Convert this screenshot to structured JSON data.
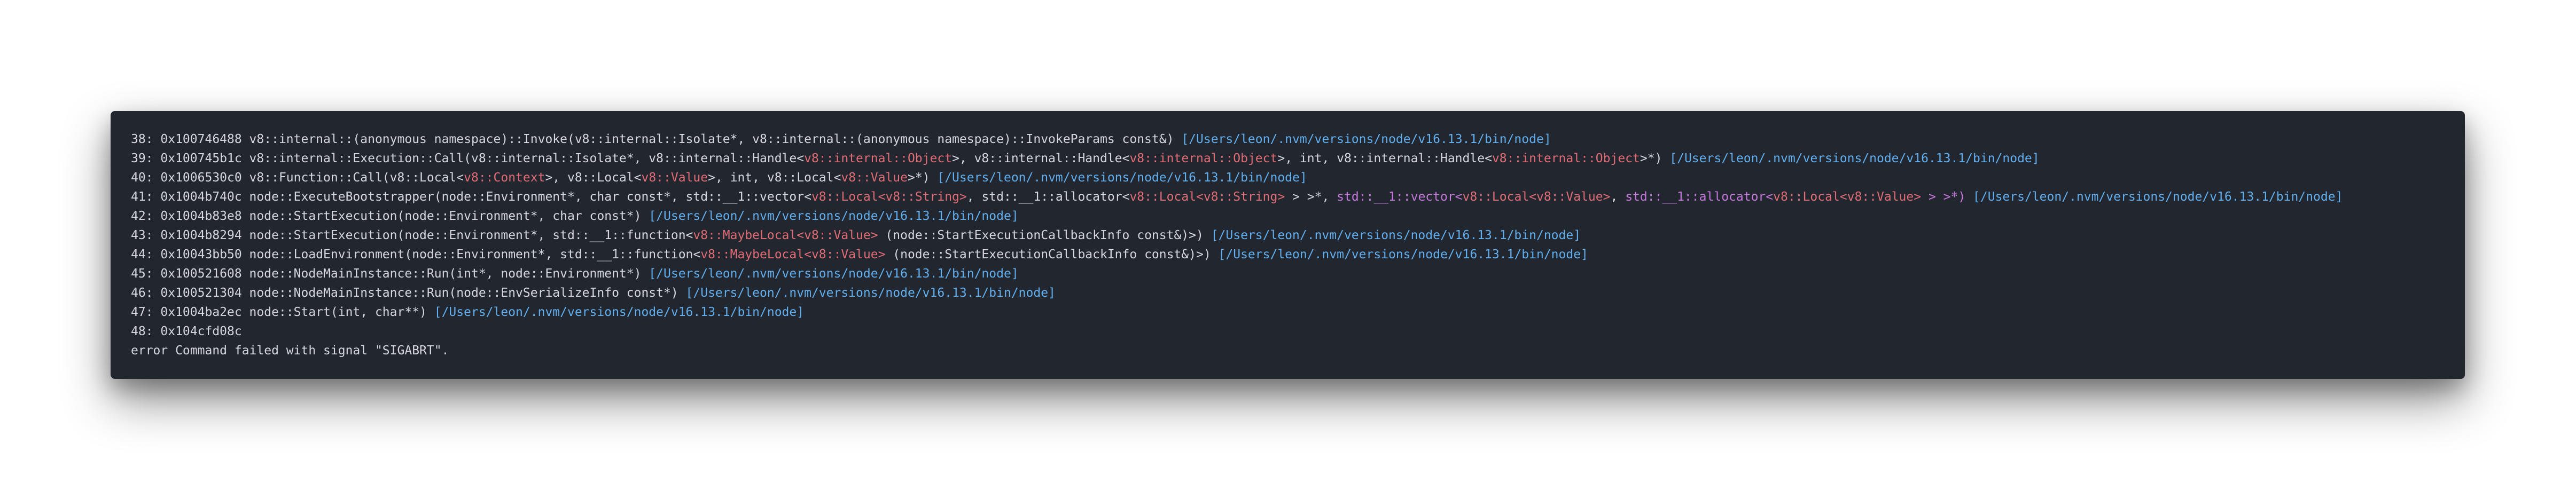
{
  "colors": {
    "background": "#22262e",
    "text": "#d4d8de",
    "type_highlight": "#e06c75",
    "path": "#61afef",
    "namespace": "#c678dd"
  },
  "lines": [
    [
      {
        "t": "38: 0x100746488 v8::internal::(anonymous namespace)::Invoke(v8::internal::Isolate*, v8::internal::(anonymous namespace)::InvokeParams const&) ",
        "c": "plain"
      },
      {
        "t": "[/Users/leon/.nvm/versions/node/v16.13.1/bin/node]",
        "c": "path"
      }
    ],
    [
      {
        "t": "39: 0x100745b1c v8::internal::Execution::Call(v8::internal::Isolate*, v8::internal::Handle<",
        "c": "plain"
      },
      {
        "t": "v8::internal::Object",
        "c": "type"
      },
      {
        "t": ">, v8::internal::Handle<",
        "c": "plain"
      },
      {
        "t": "v8::internal::Object",
        "c": "type"
      },
      {
        "t": ">, int, v8::internal::Handle<",
        "c": "plain"
      },
      {
        "t": "v8::internal::Object",
        "c": "type"
      },
      {
        "t": ">*) ",
        "c": "plain"
      },
      {
        "t": "[/Users/leon/.nvm/versions/node/v16.13.1/bin/node]",
        "c": "path"
      }
    ],
    [
      {
        "t": "40: 0x1006530c0 v8::Function::Call(v8::Local<",
        "c": "plain"
      },
      {
        "t": "v8::Context",
        "c": "type"
      },
      {
        "t": ">, v8::Local<",
        "c": "plain"
      },
      {
        "t": "v8::Value",
        "c": "type"
      },
      {
        "t": ">, int, v8::Local<",
        "c": "plain"
      },
      {
        "t": "v8::Value",
        "c": "type"
      },
      {
        "t": ">*) ",
        "c": "plain"
      },
      {
        "t": "[/Users/leon/.nvm/versions/node/v16.13.1/bin/node]",
        "c": "path"
      }
    ],
    [
      {
        "t": "41: 0x1004b740c node::ExecuteBootstrapper(node::Environment*, char const*, std::__1::vector<",
        "c": "plain"
      },
      {
        "t": "v8::Local<v8::String>",
        "c": "type"
      },
      {
        "t": ", std::__1::allocator<",
        "c": "plain"
      },
      {
        "t": "v8::Local<v8::String>",
        "c": "type"
      },
      {
        "t": " > >*, ",
        "c": "plain"
      },
      {
        "t": "std::__1::vector<",
        "c": "ns"
      },
      {
        "t": "v8::Local<v8::Value>",
        "c": "type"
      },
      {
        "t": ", ",
        "c": "plain"
      },
      {
        "t": "std::__1::allocator<",
        "c": "ns"
      },
      {
        "t": "v8::Local<v8::Value>",
        "c": "type"
      },
      {
        "t": " > >*) ",
        "c": "ns"
      },
      {
        "t": "[/Users/leon/.nvm/versions/node/v16.13.1/bin/node]",
        "c": "path"
      }
    ],
    [
      {
        "t": "42: 0x1004b83e8 node::StartExecution(node::Environment*, char const*) ",
        "c": "plain"
      },
      {
        "t": "[/Users/leon/.nvm/versions/node/v16.13.1/bin/node]",
        "c": "path"
      }
    ],
    [
      {
        "t": "43: 0x1004b8294 node::StartExecution(node::Environment*, std::__1::function<",
        "c": "plain"
      },
      {
        "t": "v8::MaybeLocal<v8::Value>",
        "c": "type"
      },
      {
        "t": " (node::StartExecutionCallbackInfo const&)>) ",
        "c": "plain"
      },
      {
        "t": "[/Users/leon/.nvm/versions/node/v16.13.1/bin/node]",
        "c": "path"
      }
    ],
    [
      {
        "t": "44: 0x10043bb50 node::LoadEnvironment(node::Environment*, std::__1::function<",
        "c": "plain"
      },
      {
        "t": "v8::MaybeLocal<v8::Value>",
        "c": "type"
      },
      {
        "t": " (node::StartExecutionCallbackInfo const&)>) ",
        "c": "plain"
      },
      {
        "t": "[/Users/leon/.nvm/versions/node/v16.13.1/bin/node]",
        "c": "path"
      }
    ],
    [
      {
        "t": "45: 0x100521608 node::NodeMainInstance::Run(int*, node::Environment*) ",
        "c": "plain"
      },
      {
        "t": "[/Users/leon/.nvm/versions/node/v16.13.1/bin/node]",
        "c": "path"
      }
    ],
    [
      {
        "t": "46: 0x100521304 node::NodeMainInstance::Run(node::EnvSerializeInfo const*) ",
        "c": "plain"
      },
      {
        "t": "[/Users/leon/.nvm/versions/node/v16.13.1/bin/node]",
        "c": "path"
      }
    ],
    [
      {
        "t": "47: 0x1004ba2ec node::Start(int, char**) ",
        "c": "plain"
      },
      {
        "t": "[/Users/leon/.nvm/versions/node/v16.13.1/bin/node]",
        "c": "path"
      }
    ],
    [
      {
        "t": "48: 0x104cfd08c",
        "c": "plain"
      }
    ],
    [
      {
        "t": "error Command failed with signal \"SIGABRT\".",
        "c": "plain"
      }
    ]
  ]
}
